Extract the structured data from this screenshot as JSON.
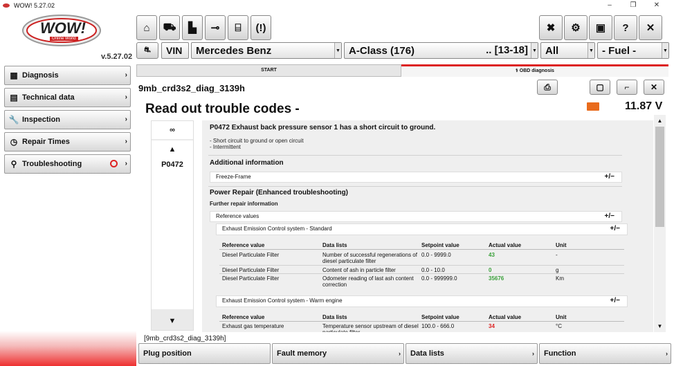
{
  "window": {
    "title": "WOW! 5.27.02",
    "min": "–",
    "max": "❐",
    "close": "✕"
  },
  "logo": {
    "text": "WOW!",
    "tagline": "Online World"
  },
  "version": "v.5.27.02",
  "sidebar": {
    "items": [
      {
        "label": "Diagnosis",
        "icon": "diagnosis-icon"
      },
      {
        "label": "Technical data",
        "icon": "technical-data-icon"
      },
      {
        "label": "Inspection",
        "icon": "wrench-icon"
      },
      {
        "label": "Repair Times",
        "icon": "clock-icon"
      },
      {
        "label": "Troubleshooting",
        "icon": "troubleshooting-icon"
      }
    ]
  },
  "toolbar": {
    "vin": "VIN",
    "help": "?",
    "close": "✕"
  },
  "vehicle": {
    "make": "Mercedes Benz",
    "model": "A-Class (176)",
    "years": ".. [13-18]",
    "variant": "All",
    "fuel": "- Fuel -"
  },
  "tabs": {
    "start": "START",
    "obd": "OBD diagnosis"
  },
  "diag_id": "9mb_crd3s2_diag_3139h",
  "page_title": "Read out trouble codes -",
  "voltage": "11.87 V",
  "code_list": {
    "code": "P0472"
  },
  "detail": {
    "title": "P0472 Exhaust back pressure sensor 1 has a short circuit to ground.",
    "causes": [
      "- Short circuit to ground or open circuit",
      "- Intermittent"
    ],
    "additional_info": "Additional information",
    "freeze_frame": "Freeze-Frame",
    "power_repair": "Power Repair (Enhanced troubleshooting)",
    "further_info": "Further repair information",
    "reference_values": "Reference values",
    "plusminus": "+/−",
    "group1": "Exhaust Emission Control system - Standard",
    "group2": "Exhaust Emission Control system - Warm engine",
    "columns": [
      "Reference value",
      "Data lists",
      "Setpoint value",
      "Actual value",
      "Unit"
    ],
    "rows1": [
      {
        "ref": "Diesel Particulate Filter",
        "data": "Number of successful regenerations of diesel particulate filter",
        "setpoint": "0.0 - 9999.0",
        "actual": "43",
        "unit": "-"
      },
      {
        "ref": "Diesel Particulate Filter",
        "data": "Content of ash in particle filter",
        "setpoint": "0.0 - 10.0",
        "actual": "0",
        "unit": "g"
      },
      {
        "ref": "Diesel Particulate Filter",
        "data": "Odometer reading of last ash content correction",
        "setpoint": "0.0 - 999999.0",
        "actual": "35676",
        "unit": "Km"
      }
    ],
    "rows2": [
      {
        "ref": "Exhaust gas temperature",
        "data": "Temperature sensor upstream of diesel particulate filter",
        "setpoint": "100.0 - 666.0",
        "actual": "34",
        "unit": "°C"
      }
    ]
  },
  "footer_id": "[9mb_crd3s2_diag_3139h]",
  "bottom_buttons": [
    "Plug position",
    "Fault memory",
    "Data lists",
    "Function"
  ],
  "colors": {
    "accent_red": "#dd2222",
    "good": "#3aa03a",
    "battery": "#e96b1c"
  }
}
